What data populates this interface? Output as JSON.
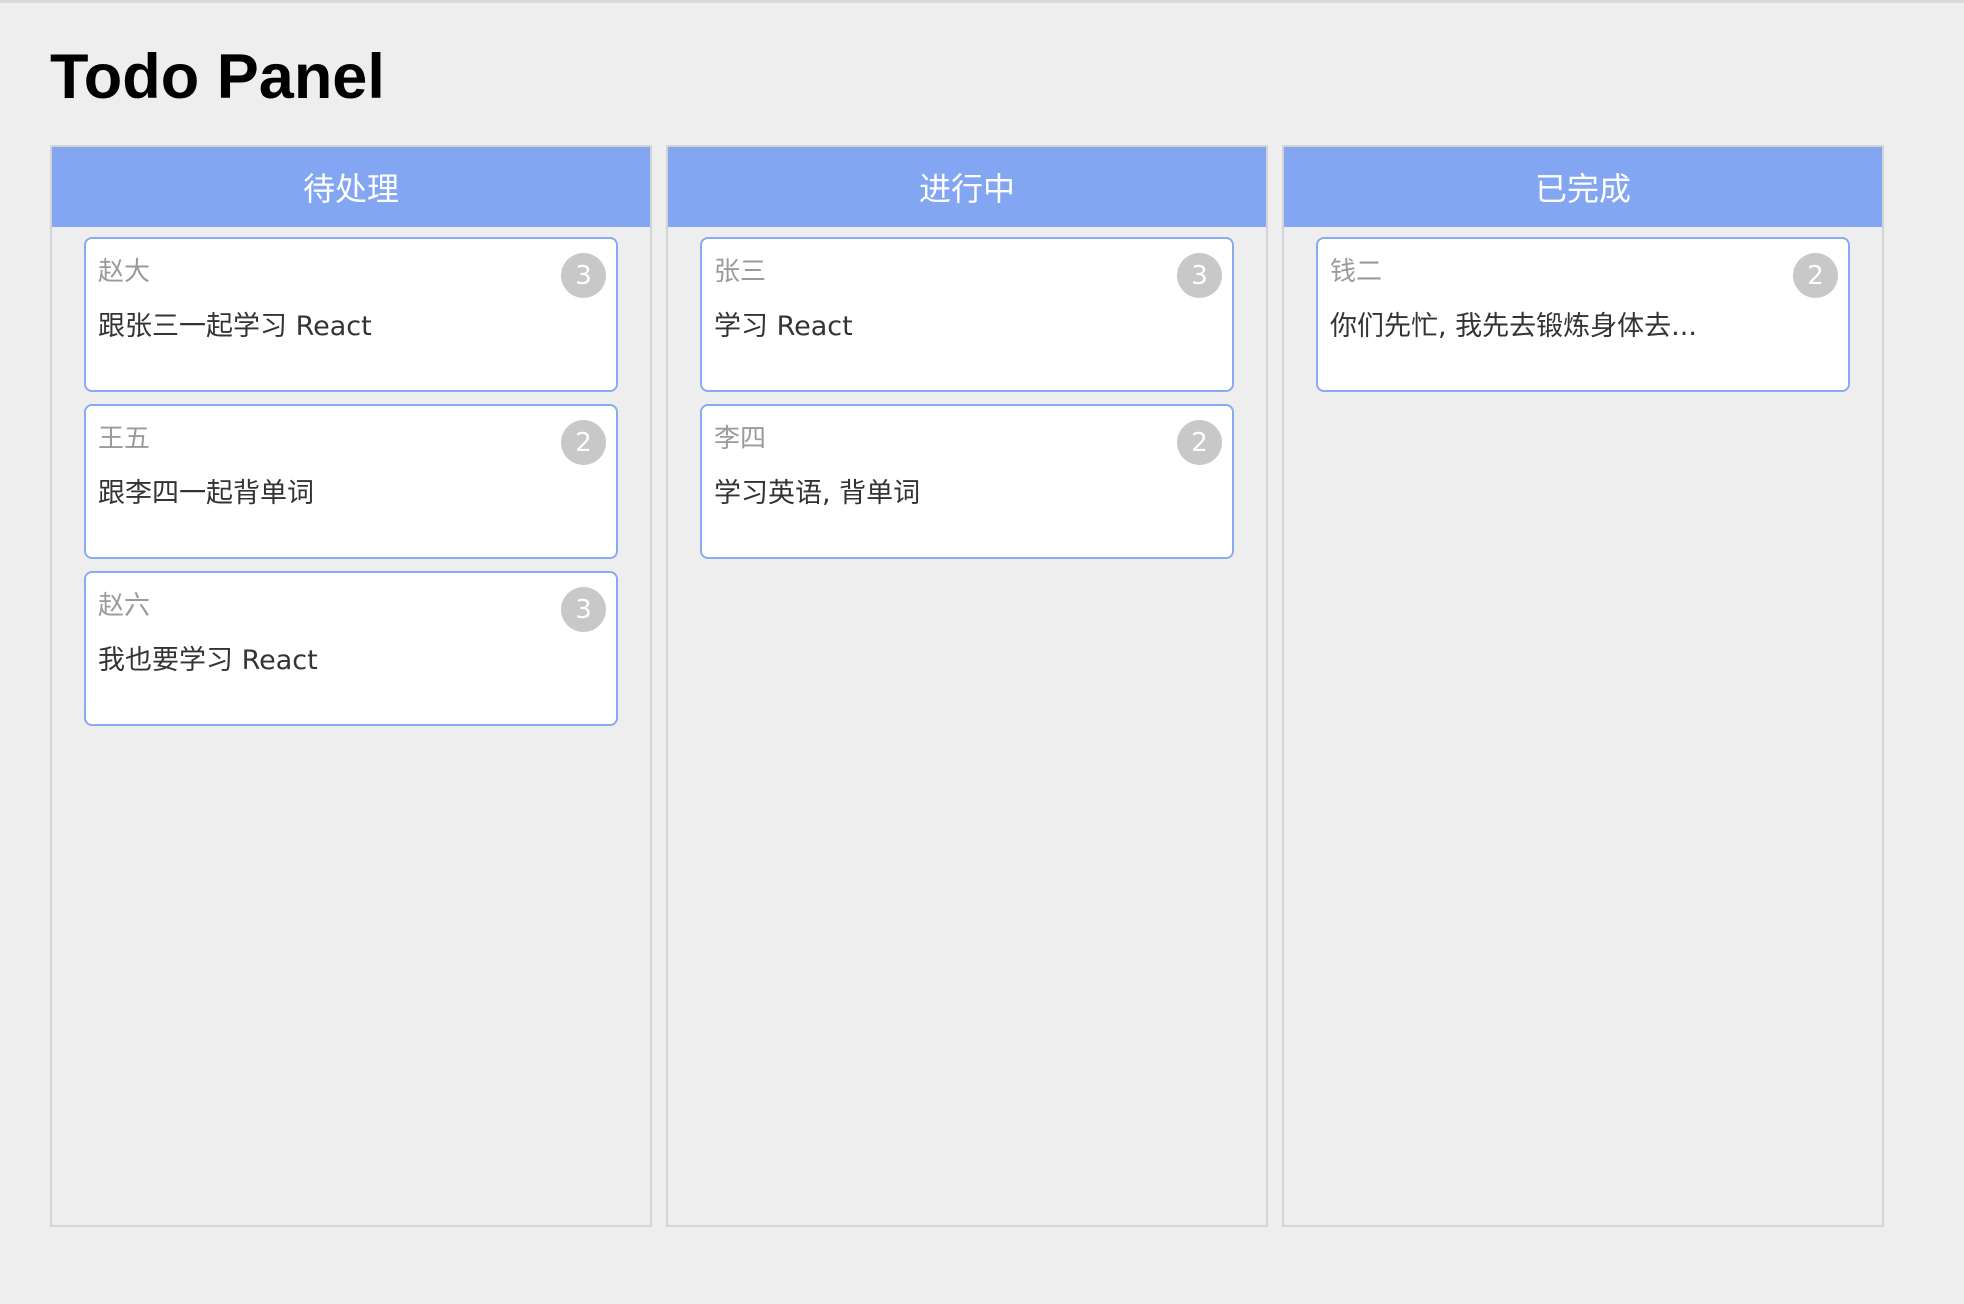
{
  "page": {
    "title": "Todo Panel"
  },
  "columns": [
    {
      "title": "待处理",
      "cards": [
        {
          "owner": "赵大",
          "text": "跟张三一起学习 React",
          "count": "3"
        },
        {
          "owner": "王五",
          "text": "跟李四一起背单词",
          "count": "2"
        },
        {
          "owner": "赵六",
          "text": "我也要学习 React",
          "count": "3"
        }
      ]
    },
    {
      "title": "进行中",
      "cards": [
        {
          "owner": "张三",
          "text": "学习 React",
          "count": "3"
        },
        {
          "owner": "李四",
          "text": "学习英语, 背单词",
          "count": "2"
        }
      ]
    },
    {
      "title": "已完成",
      "cards": [
        {
          "owner": "钱二",
          "text": "你们先忙, 我先去锻炼身体去...",
          "count": "2"
        }
      ]
    }
  ],
  "colors": {
    "header": "#82a6f1",
    "card_border": "#8aaaf0",
    "badge": "#c8c8c8",
    "background": "#efeeef"
  }
}
